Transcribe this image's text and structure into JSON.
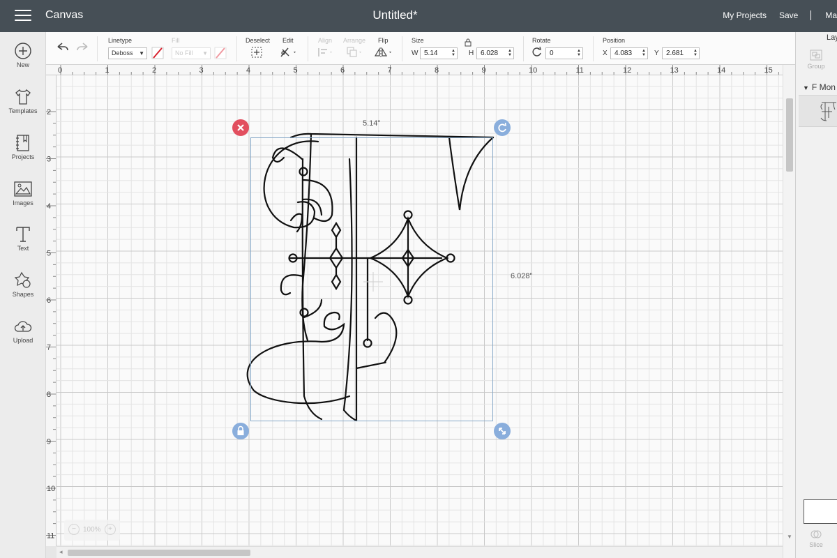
{
  "topbar": {
    "app_title": "Canvas",
    "doc_title": "Untitled*",
    "my_projects": "My Projects",
    "save": "Save",
    "cut_off": "Ma"
  },
  "toolbar": {
    "linetype_label": "Linetype",
    "linetype_value": "Deboss",
    "fill_label": "Fill",
    "fill_value": "No Fill",
    "deselect_label": "Deselect",
    "edit_label": "Edit",
    "align_label": "Align",
    "arrange_label": "Arrange",
    "flip_label": "Flip",
    "size_label": "Size",
    "w_label": "W",
    "w_value": "5.14",
    "h_label": "H",
    "h_value": "6.028",
    "rotate_label": "Rotate",
    "rotate_value": "0",
    "position_label": "Position",
    "x_label": "X",
    "x_value": "4.083",
    "y_label": "Y",
    "y_value": "2.681"
  },
  "sidebar": {
    "items": [
      {
        "label": "New",
        "icon": "plus-circle-icon"
      },
      {
        "label": "Templates",
        "icon": "shirt-icon"
      },
      {
        "label": "Projects",
        "icon": "notebook-icon"
      },
      {
        "label": "Images",
        "icon": "image-icon"
      },
      {
        "label": "Text",
        "icon": "text-icon"
      },
      {
        "label": "Shapes",
        "icon": "shapes-icon"
      },
      {
        "label": "Upload",
        "icon": "cloud-upload-icon"
      }
    ]
  },
  "rulers": {
    "top": [
      "0",
      "1",
      "2",
      "3",
      "4",
      "5",
      "6",
      "7",
      "8",
      "9",
      "10",
      "11",
      "12",
      "13",
      "14",
      "15"
    ],
    "left": [
      "2",
      "3",
      "4",
      "5",
      "6",
      "7",
      "8",
      "9",
      "10",
      "11"
    ]
  },
  "selection": {
    "width_label": "5.14\"",
    "height_label": "6.028\"",
    "delete_color": "#e24f5f",
    "handle_color": "#8aaedc"
  },
  "zoom": {
    "value": "100%"
  },
  "right_panel": {
    "tab": "Lay",
    "group": "Group",
    "layer_name": "F Mon",
    "slice": "Slice"
  }
}
